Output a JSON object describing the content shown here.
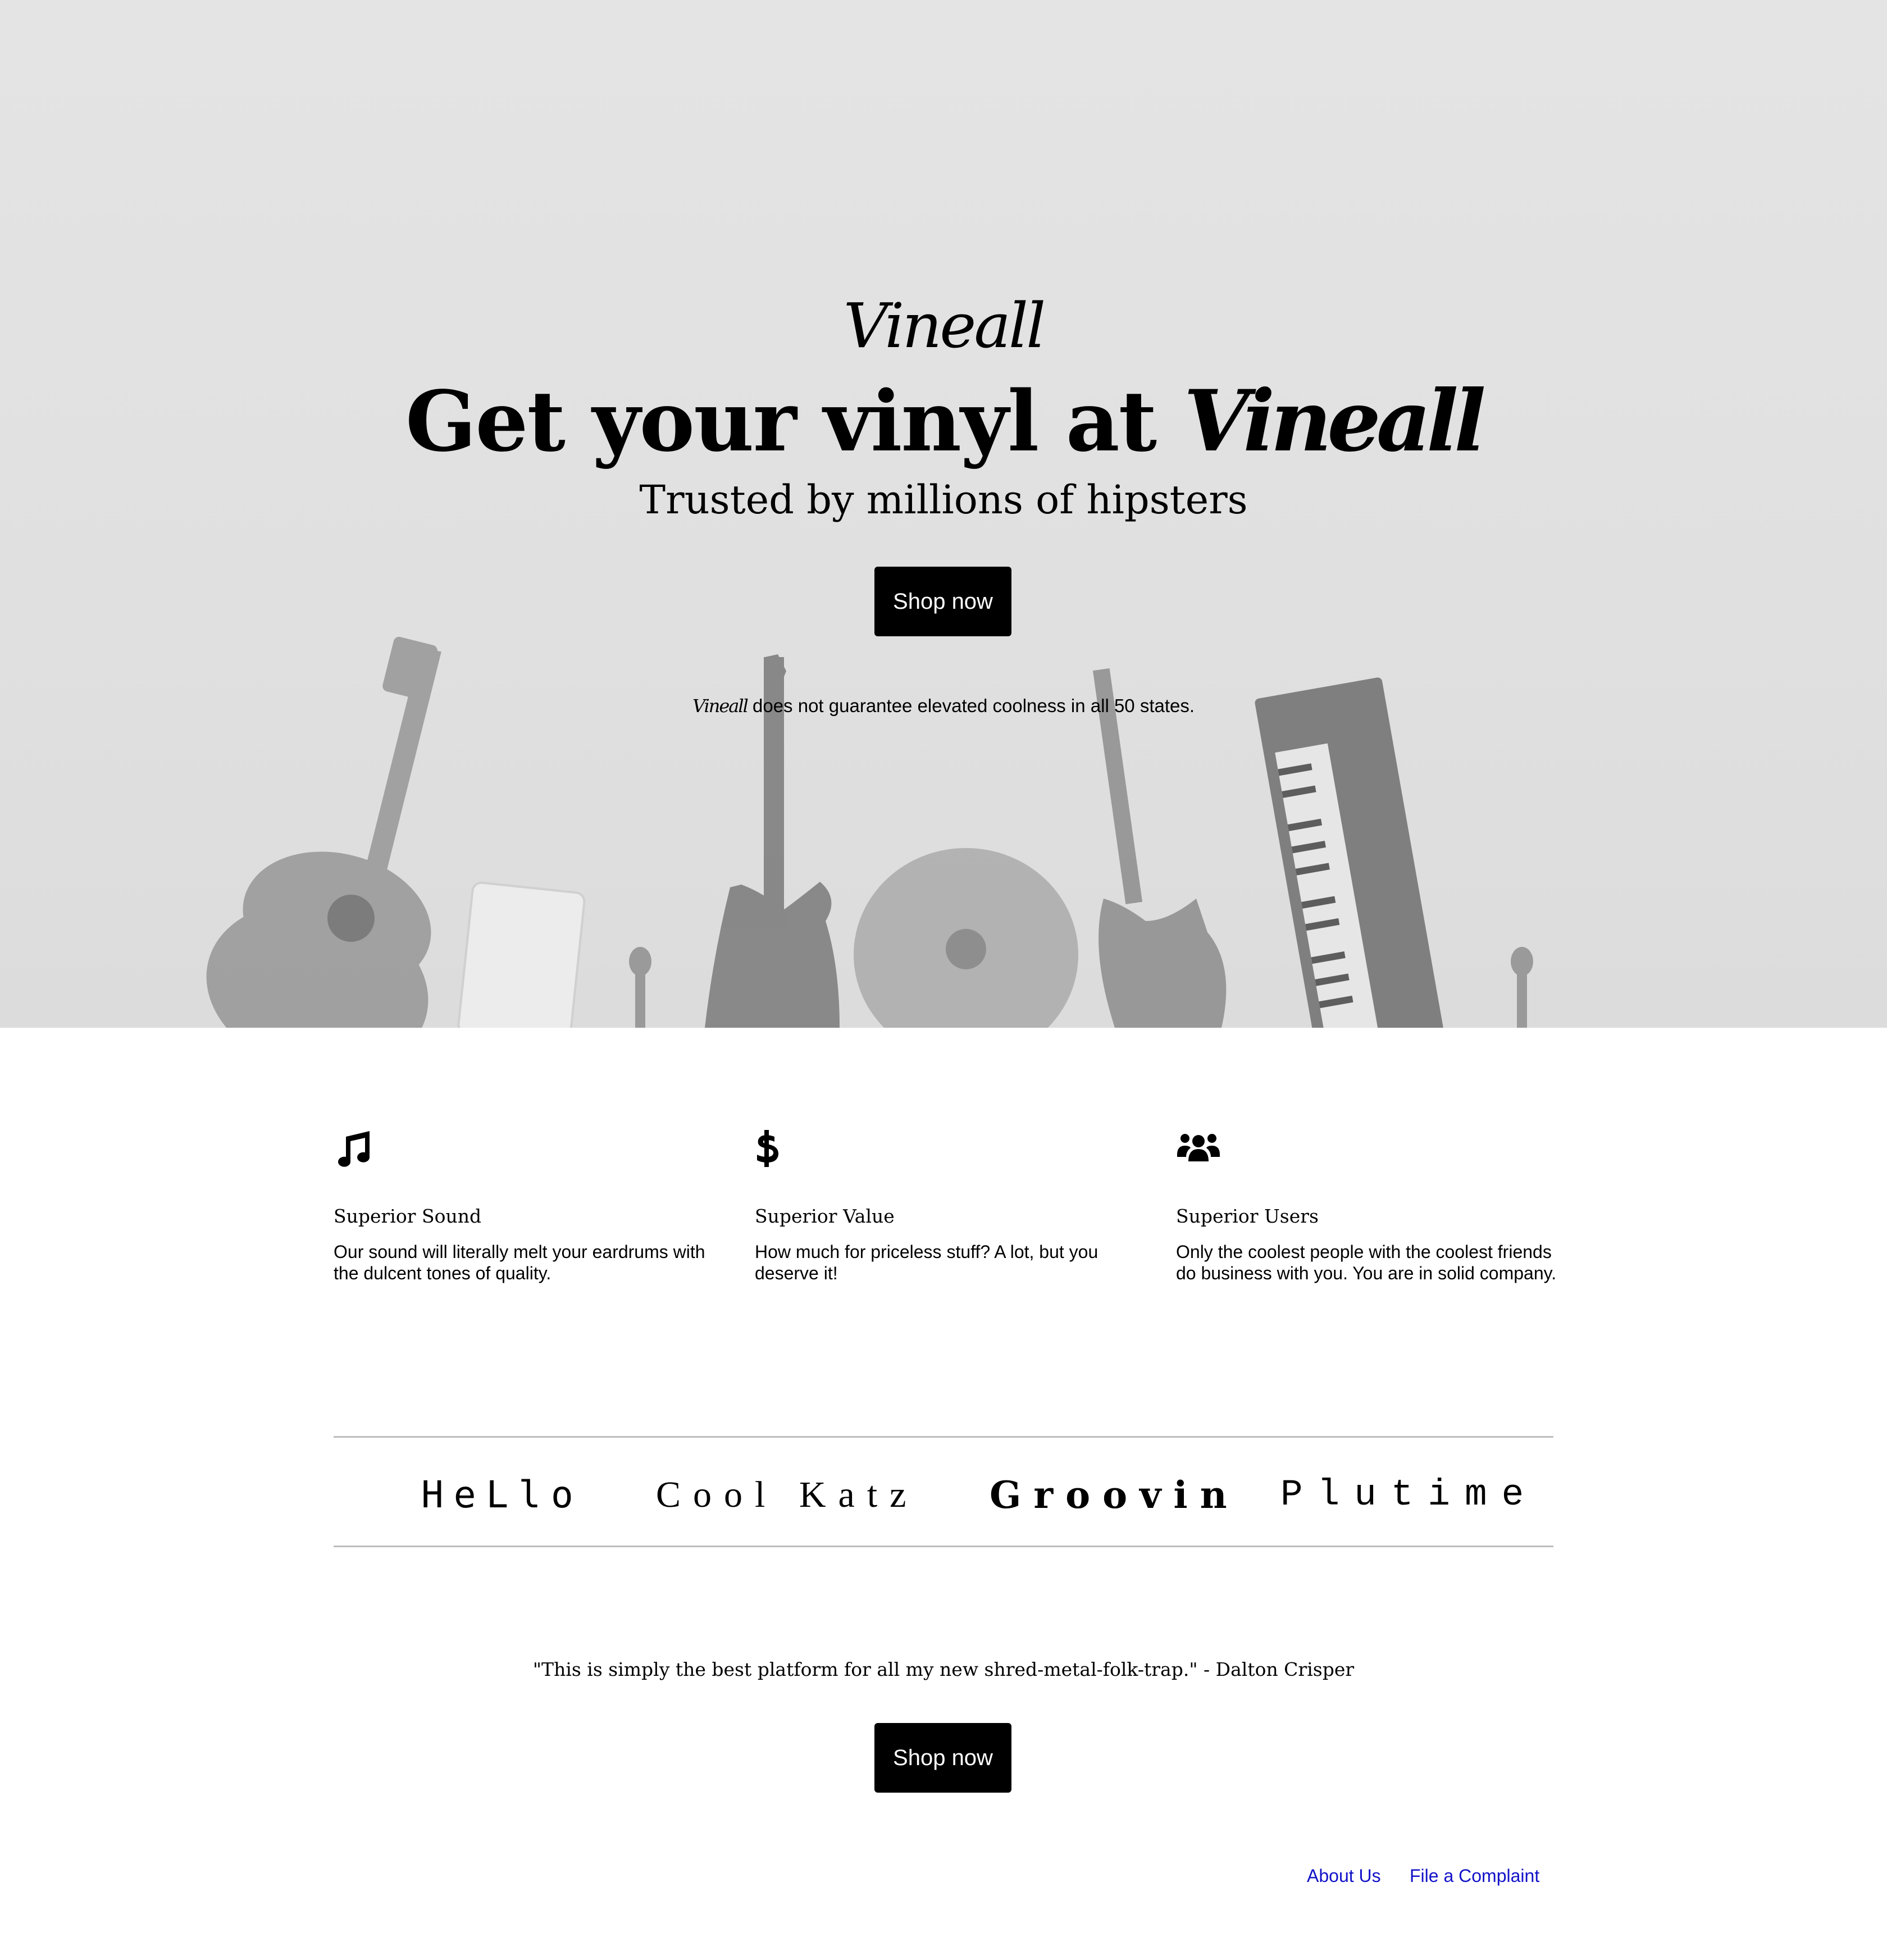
{
  "hero": {
    "logo": "Vineall",
    "headline_prefix": "Get your vinyl at",
    "headline_brand": "Vineall",
    "subheadline": "Trusted by millions of hipsters",
    "cta_label": "Shop now",
    "disclaimer_brand": "Vineall",
    "disclaimer_text": " does not guarantee elevated coolness in all 50 states.",
    "background_image": "instruments-raised-icon"
  },
  "features": [
    {
      "icon": "music-note-icon",
      "title": "Superior Sound",
      "description": "Our sound will literally melt your eardrums with the dulcent tones of quality."
    },
    {
      "icon": "dollar-icon",
      "title": "Superior Value",
      "description": "How much for priceless stuff? A lot, but you deserve it!"
    },
    {
      "icon": "users-icon",
      "title": "Superior Users",
      "description": "Only the coolest people with the coolest friends do business with you. You are in solid company."
    }
  ],
  "partners": [
    "HeLlo",
    "Cool Katz",
    "Groovin",
    "Plutime"
  ],
  "testimonial": {
    "quote": "\"This is simply the best platform for all my new shred-metal-folk-trap.\" - Dalton Crisper",
    "cta_label": "Shop now"
  },
  "footer": {
    "links": [
      "About Us",
      "File a Complaint"
    ]
  },
  "colors": {
    "hero_bg": "#e0e0e0",
    "button_bg": "#000000",
    "button_text": "#ffffff",
    "link": "#1212c8",
    "rule": "#bdbdbd"
  }
}
